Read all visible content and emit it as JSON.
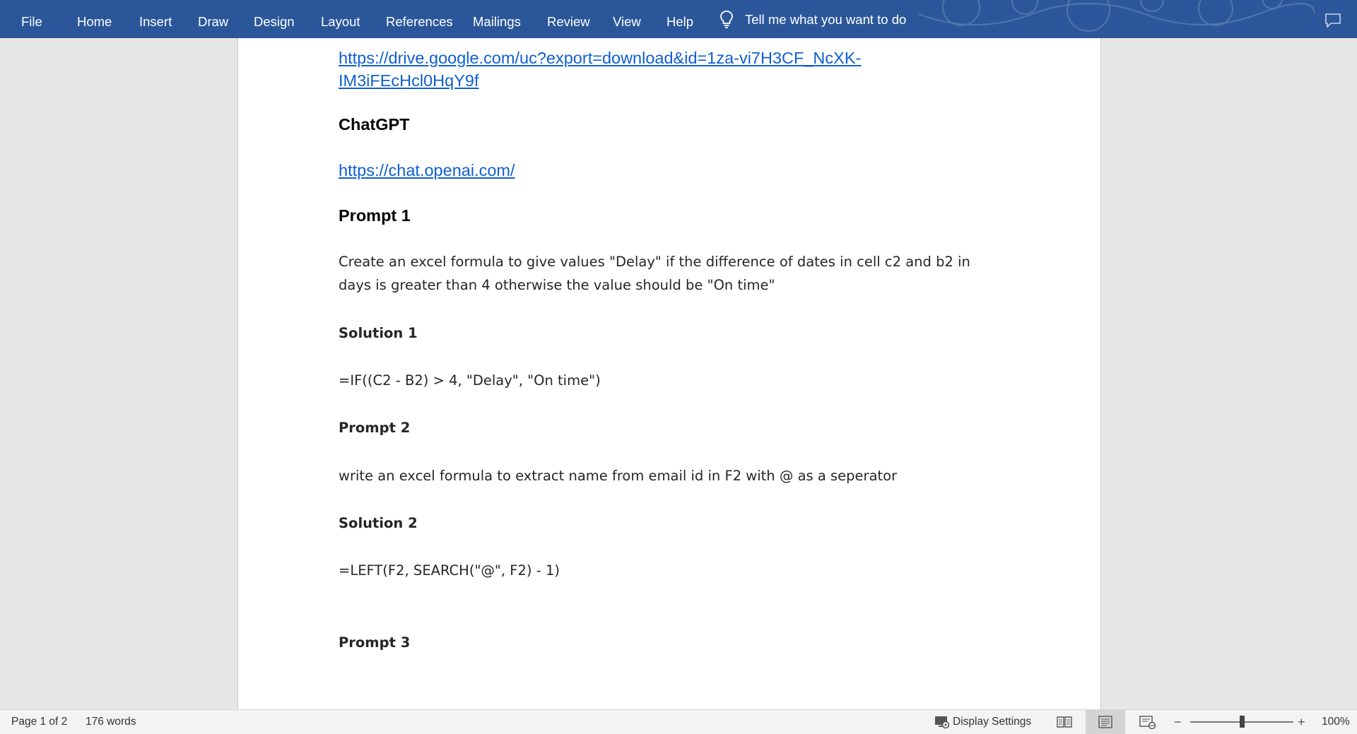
{
  "ribbon": {
    "tabs": [
      "File",
      "Home",
      "Insert",
      "Draw",
      "Design",
      "Layout",
      "References",
      "Mailings",
      "Review",
      "View",
      "Help"
    ],
    "tell_me": "Tell me what you want to do"
  },
  "document": {
    "link1_line1": "https://drive.google.com/uc?export=download&id=1za-vi7H3CF_NcXK-",
    "link1_line2": "IM3iFEcHcl0HqY9f",
    "heading_chatgpt": "ChatGPT",
    "link2": "https://chat.openai.com/",
    "heading_prompt1": "Prompt 1",
    "prompt1_line1": "Create an excel formula to give values  \"Delay\" if the difference of dates in cell c2 and b2 in",
    "prompt1_line2": "days is greater than 4 otherwise the value should be \"On time\"",
    "solution1_heading": "Solution 1",
    "solution1_formula": "=IF((C2 - B2) > 4, \"Delay\", \"On time\")",
    "prompt2_heading": "Prompt 2",
    "prompt2_text": "write an excel formula to extract name from email id in F2 with @ as a seperator",
    "solution2_heading": "Solution 2",
    "solution2_formula": "=LEFT(F2, SEARCH(\"@\", F2) - 1)",
    "prompt3_heading": "Prompt 3"
  },
  "status": {
    "page": "Page 1 of 2",
    "words": "176 words",
    "display_settings": "Display Settings",
    "zoom_minus": "−",
    "zoom_plus": "+",
    "zoom_level": "100%",
    "zoom_fraction": 0.5
  },
  "colors": {
    "ribbon": "#2b579a",
    "link": "#0f5fd0",
    "page": "#ffffff",
    "canvas": "#e6e6e6"
  },
  "icons": {
    "tell_me": "lightbulb-icon",
    "comment": "comment-icon",
    "display": "display-settings-icon"
  }
}
